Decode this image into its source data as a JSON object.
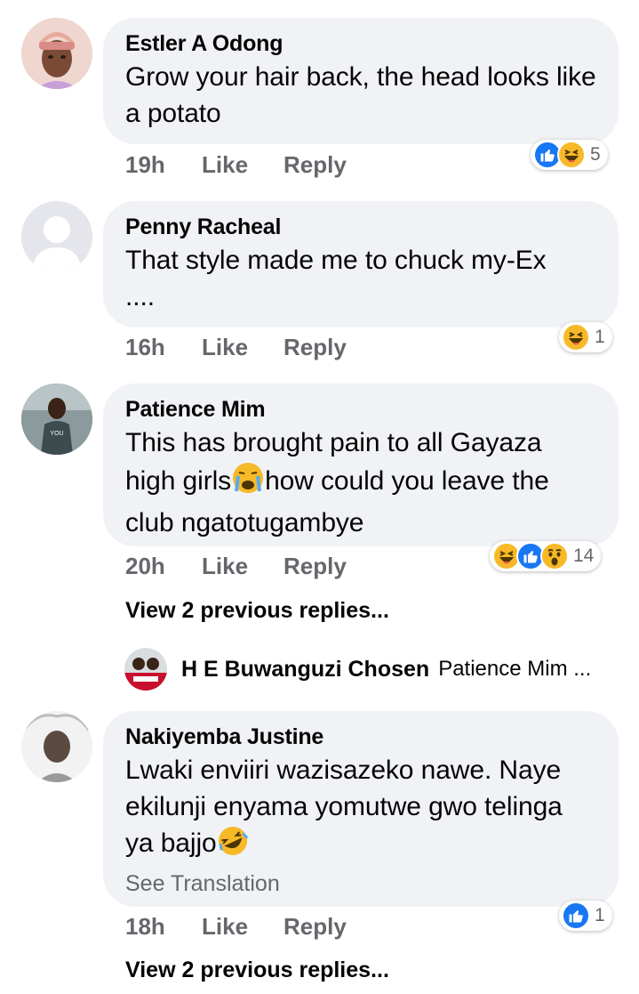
{
  "comments": [
    {
      "author": "Estler A Odong",
      "text": "Grow your hair back, the head looks like a potato",
      "time": "19h",
      "like_label": "Like",
      "reply_label": "Reply",
      "reactions": [
        "like",
        "haha"
      ],
      "reaction_count": "5"
    },
    {
      "author": "Penny Racheal",
      "text": "That style made me to chuck my-Ex ....",
      "time": "16h",
      "like_label": "Like",
      "reply_label": "Reply",
      "reactions": [
        "haha"
      ],
      "reaction_count": "1"
    },
    {
      "author": "Patience Mim",
      "text_part1": "This has brought pain to all Gayaza high girls",
      "text_emoji": "crying-face",
      "text_part2": "how could you leave the club ngatotugambye",
      "time": "20h",
      "like_label": "Like",
      "reply_label": "Reply",
      "reactions": [
        "haha",
        "like",
        "wow"
      ],
      "reaction_count": "14",
      "view_previous": "View 2 previous replies...",
      "reply_preview": {
        "author": "H E Buwanguzi Chosen",
        "text": "Patience Mim ..."
      }
    },
    {
      "author": "Nakiyemba Justine",
      "text": "Lwaki enviiri wazisazeko nawe. Naye ekilunji enyama yomutwe gwo telinga ya bajjo",
      "text_emoji": "rolling-laughing-face",
      "see_translation": "See Translation",
      "time": "18h",
      "like_label": "Like",
      "reply_label": "Reply",
      "reactions": [
        "like"
      ],
      "reaction_count": "1",
      "view_previous": "View 2 previous replies..."
    }
  ],
  "colors": {
    "bubble": "#f0f2f5",
    "meta": "#65676b",
    "like_blue": "#1877f2",
    "emoji_yellow": "#f7b928"
  }
}
